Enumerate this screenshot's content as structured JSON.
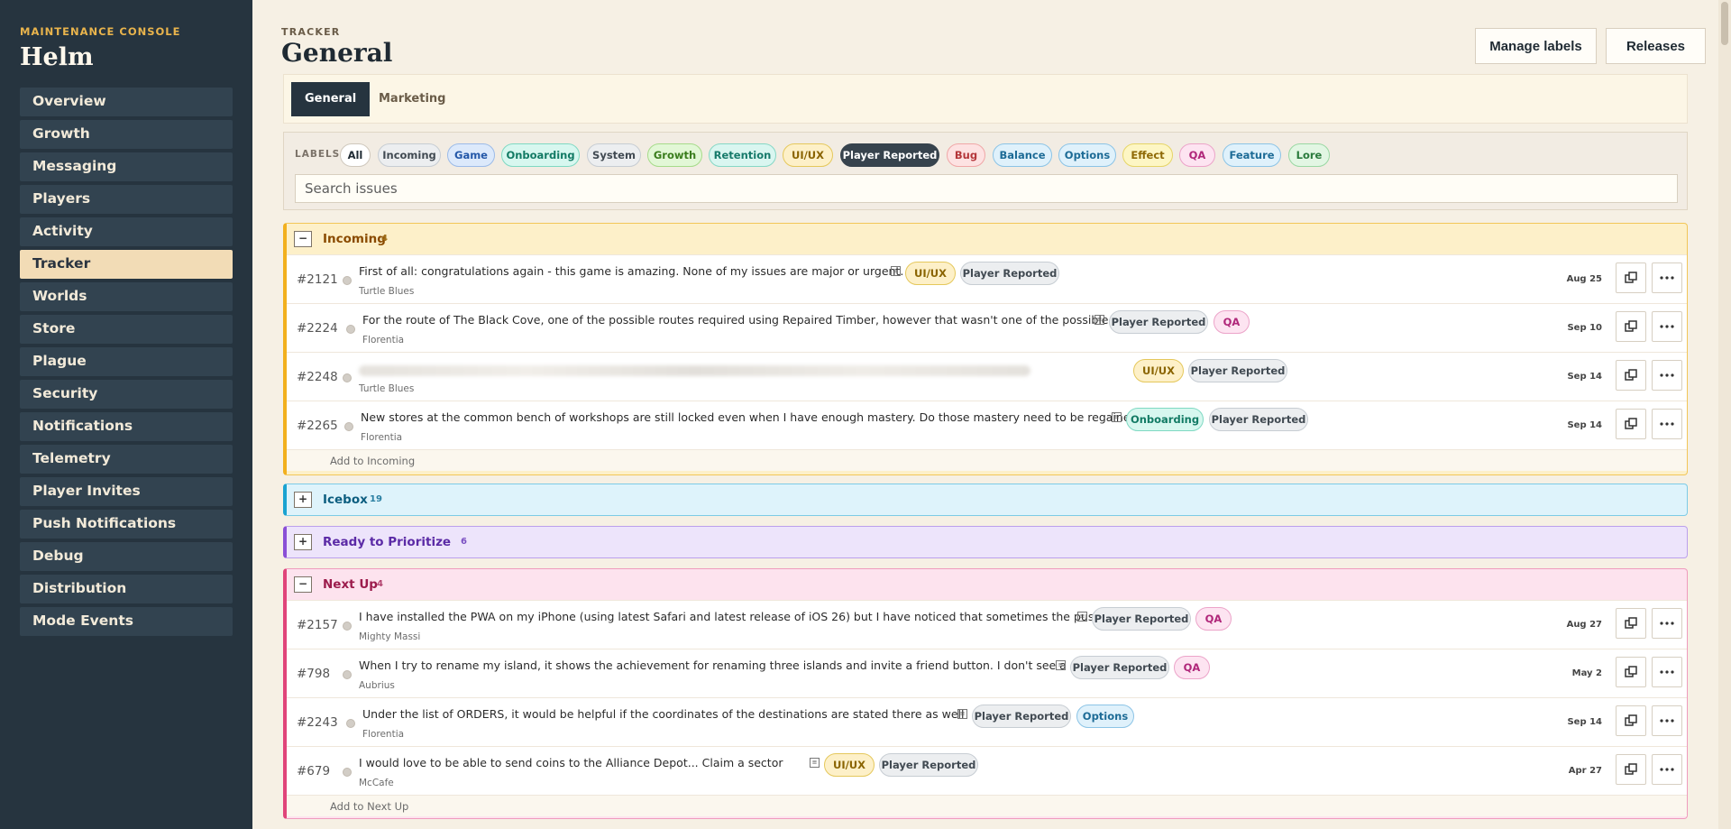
{
  "sidebar": {
    "eyebrow": "MAINTENANCE CONSOLE",
    "brand": "Helm",
    "items": [
      {
        "label": "Overview"
      },
      {
        "label": "Growth"
      },
      {
        "label": "Messaging"
      },
      {
        "label": "Players"
      },
      {
        "label": "Activity"
      },
      {
        "label": "Tracker"
      },
      {
        "label": "Worlds"
      },
      {
        "label": "Store"
      },
      {
        "label": "Plague"
      },
      {
        "label": "Security"
      },
      {
        "label": "Notifications"
      },
      {
        "label": "Telemetry"
      },
      {
        "label": "Player Invites"
      },
      {
        "label": "Push Notifications"
      },
      {
        "label": "Debug"
      },
      {
        "label": "Distribution"
      },
      {
        "label": "Mode Events"
      }
    ],
    "active_item": "Tracker"
  },
  "header": {
    "eyebrow": "TRACKER",
    "title": "General",
    "manage_labels": "Manage labels",
    "releases": "Releases"
  },
  "tabs": [
    {
      "label": "General",
      "active": true
    },
    {
      "label": "Marketing",
      "active": false
    }
  ],
  "labels_filter": {
    "title": "LABELS",
    "chips": [
      "All",
      "Incoming",
      "Game",
      "Onboarding",
      "System",
      "Growth",
      "Retention",
      "UI/UX",
      "Player Reported",
      "Bug",
      "Balance",
      "Options",
      "Effect",
      "QA",
      "Feature",
      "Lore"
    ],
    "selected": [
      "All",
      "Player Reported"
    ]
  },
  "search": {
    "placeholder": "Search issues"
  },
  "groups": [
    {
      "name": "Incoming",
      "count": "4",
      "expanded": true,
      "color": "#f2b01e",
      "issues": [
        {
          "num": "#2121",
          "title": "First of all: congratulations again - this game is amazing. None of my issues are major or urgent.",
          "author": "Turtle Blues",
          "labels": [
            "UI/UX",
            "Player Reported"
          ],
          "date": "Aug 25"
        },
        {
          "num": "#2224",
          "title": "For the route of The Black Cove, one of the possible routes required using Repaired Timber, however that wasn't one of the possible voyag...",
          "author": "Florentia",
          "labels": [
            "Player Reported",
            "QA"
          ],
          "date": "Sep 10"
        },
        {
          "num": "#2248",
          "title": "",
          "author": "Turtle Blues",
          "labels": [
            "UI/UX",
            "Player Reported"
          ],
          "date": "Sep 14"
        },
        {
          "num": "#2265",
          "title": "New stores at the common bench of workshops are still locked even when I have enough mastery. Do those mastery need to be regained like e...",
          "author": "Florentia",
          "labels": [
            "Onboarding",
            "Player Reported"
          ],
          "date": "Sep 14"
        }
      ],
      "add_label": "Add to Incoming"
    },
    {
      "name": "Icebox",
      "count": "19",
      "expanded": false,
      "color": "#1aa3d1"
    },
    {
      "name": "Ready to Prioritize",
      "count": "6",
      "expanded": false,
      "color": "#8a4fd6"
    },
    {
      "name": "Next Up",
      "count": "4",
      "expanded": true,
      "color": "#e0447a",
      "issues": [
        {
          "num": "#2157",
          "title": "I have installed the PWA on my iPhone (using latest Safari and latest release of iOS 26) but I have noticed that sometimes the push notif...",
          "author": "Mighty Massi",
          "labels": [
            "Player Reported",
            "QA"
          ],
          "date": "Aug 27"
        },
        {
          "num": "#798",
          "title": "When I try to rename my island, it shows the achievement for renaming three islands and invite a friend button. I don't see a place to ac...",
          "author": "Aubrius",
          "labels": [
            "Player Reported",
            "QA"
          ],
          "date": "May 2"
        },
        {
          "num": "#2243",
          "title": "Under the list of ORDERS, it would be helpful if the coordinates of the destinations are stated there as well",
          "author": "Florentia",
          "labels": [
            "Player Reported",
            "Options"
          ],
          "date": "Sep 14"
        },
        {
          "num": "#679",
          "title": "I would love to be able to send coins to the Alliance Depot... Claim a sector",
          "author": "McCafe",
          "labels": [
            "UI/UX",
            "Player Reported"
          ],
          "date": "Apr 27"
        }
      ],
      "add_label": "Add to Next Up"
    }
  ],
  "icons": {
    "toggle_expanded": "−",
    "toggle_collapsed": "+",
    "copy": "copy-icon",
    "more": "more-icon",
    "note": "note-icon"
  }
}
